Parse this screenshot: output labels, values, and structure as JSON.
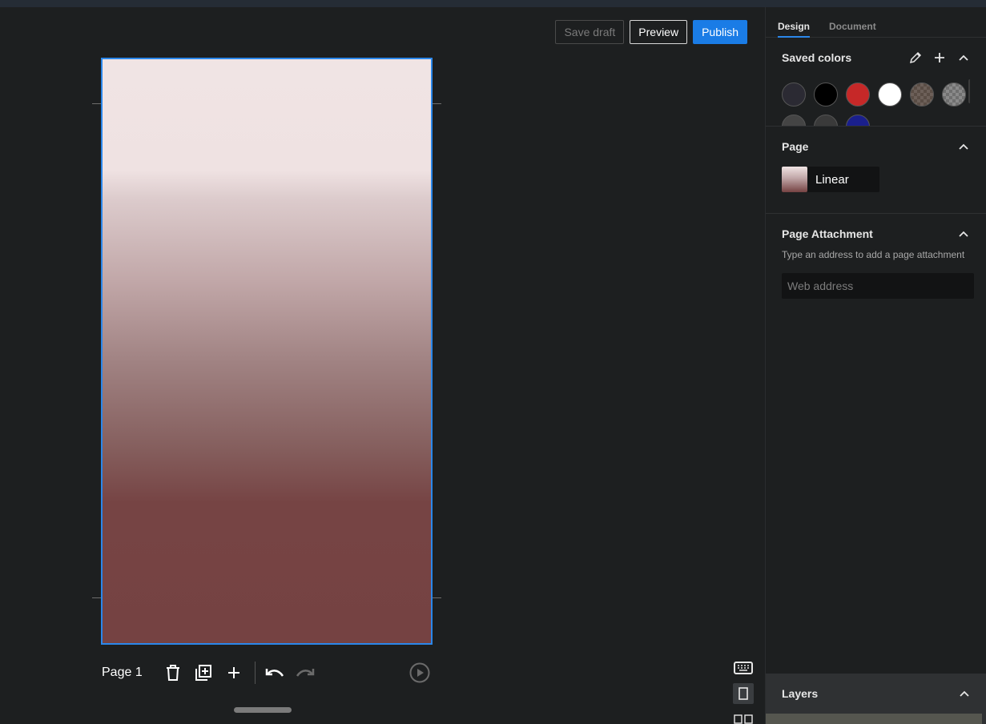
{
  "toolbar": {
    "save_draft": "Save draft",
    "preview": "Preview",
    "publish": "Publish"
  },
  "canvas": {
    "page_background": "linear gradient #f0e4e4 to #754242"
  },
  "page_bar": {
    "label": "Page 1",
    "icons": [
      "trash-icon",
      "duplicate-icon",
      "plus-icon",
      "undo-icon",
      "redo-icon",
      "play-icon"
    ]
  },
  "side_tools": [
    "keyboard-icon",
    "page-view-icon",
    "grid-view-icon"
  ],
  "sidebar": {
    "tabs": [
      {
        "label": "Design",
        "active": true
      },
      {
        "label": "Document",
        "active": false
      }
    ],
    "saved_colors": {
      "title": "Saved colors",
      "swatches": [
        "#2b2a33",
        "#000000",
        "#c62828",
        "#ffffff",
        "checker-brown",
        "checker-gray"
      ]
    },
    "page": {
      "title": "Page",
      "fill_label": "Linear"
    },
    "page_attachment": {
      "title": "Page Attachment",
      "hint": "Type an address to add a page attachment",
      "placeholder": "Web address"
    },
    "layers": {
      "title": "Layers"
    }
  },
  "colors": {
    "accent": "#1a7ce6",
    "selection": "#2b87ea"
  }
}
